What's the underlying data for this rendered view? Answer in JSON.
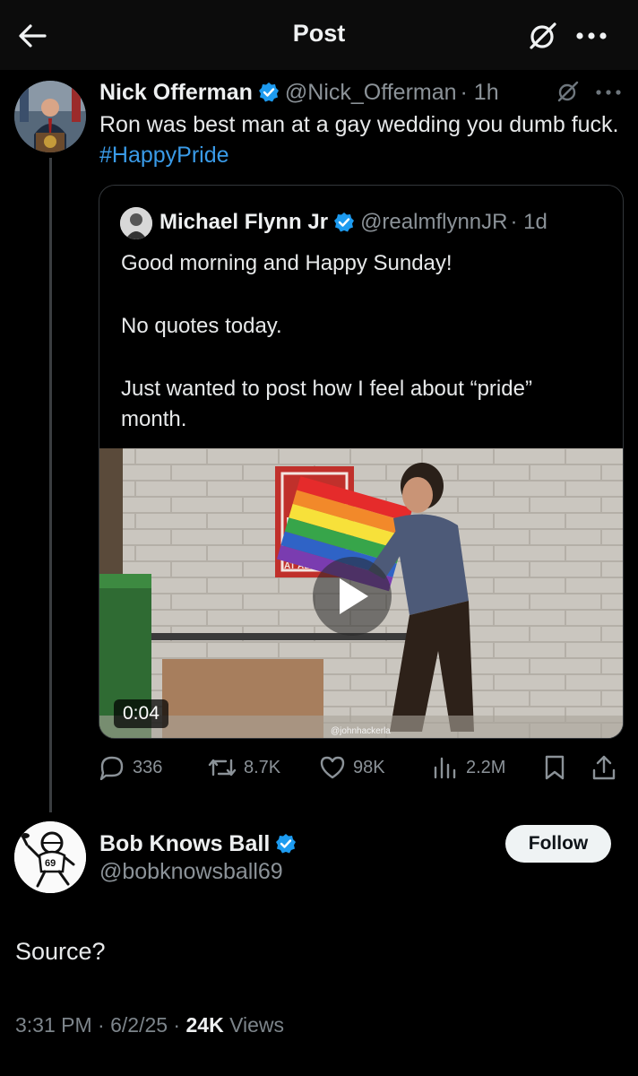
{
  "header": {
    "title": "Post"
  },
  "main_tweet": {
    "name": "Nick Offerman",
    "handle": "@Nick_Offerman",
    "time": "· 1h",
    "text": "Ron was best man at a gay wedding you dumb fuck.",
    "hashtag": "#HappyPride"
  },
  "quoted_tweet": {
    "name": "Michael Flynn Jr",
    "handle": "@realmflynnJR",
    "time": "· 1d",
    "line1": "Good morning and Happy Sunday!",
    "line2": "No quotes today.",
    "line3a": "Just wanted to post how I feel about “pride”",
    "line3b": "month.",
    "video": {
      "duration": "0:04",
      "watermark": "@johnhackerla",
      "sign_text_1": "NO",
      "sign_text_2": "F",
      "sign_text_3": "AT ALL"
    }
  },
  "actions": {
    "replies": "336",
    "reposts": "8.7K",
    "likes": "98K",
    "views": "2.2M"
  },
  "reply": {
    "name": "Bob Knows Ball",
    "handle": "@bobknowsball69",
    "follow_label": "Follow",
    "avatar_number": "69",
    "text": "Source?",
    "time": "3:31 PM",
    "date": "· 6/2/25 ·",
    "views_count": "24K",
    "views_label": "Views"
  },
  "colors": {
    "background": "#000000",
    "accent_blue": "#1d9bf0",
    "hashtag": "#3a9be8",
    "muted": "#8b9298"
  }
}
